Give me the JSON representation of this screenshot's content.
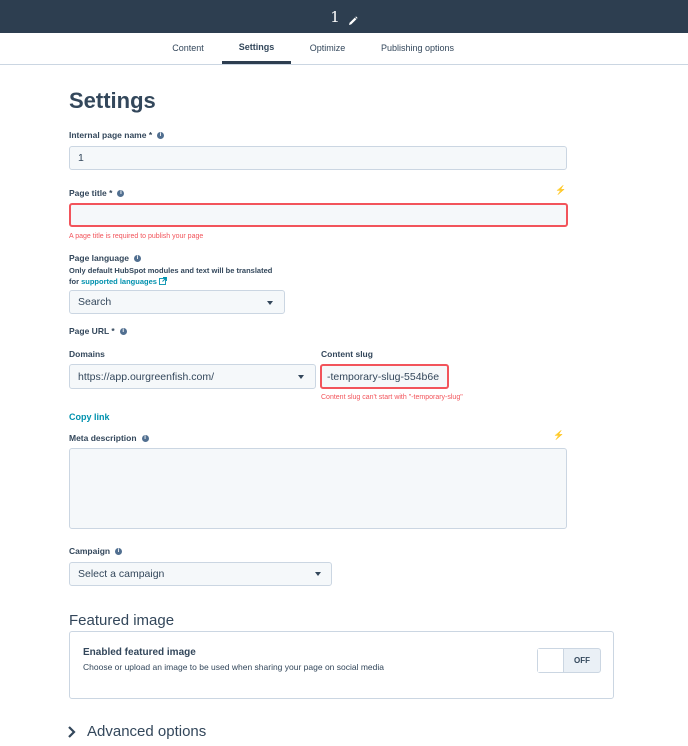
{
  "header": {
    "title": "1",
    "edit_icon": "pencil-icon"
  },
  "tabs": [
    {
      "label": "Content",
      "active": false
    },
    {
      "label": "Settings",
      "active": true
    },
    {
      "label": "Optimize",
      "active": false
    },
    {
      "label": "Publishing options",
      "active": false
    }
  ],
  "page": {
    "heading": "Settings"
  },
  "internal_name": {
    "label": "Internal page name *",
    "value": "1"
  },
  "page_title": {
    "label": "Page title *",
    "value": "",
    "error": "A page title is required to publish your page"
  },
  "page_language": {
    "label": "Page language",
    "helper_line1": "Only default HubSpot modules and text will be translated",
    "helper_prefix": "for ",
    "helper_link": "supported languages",
    "selected": "Search"
  },
  "page_url": {
    "label": "Page URL *",
    "domains_label": "Domains",
    "domain_value": "https://app.ourgreenfish.com/",
    "slug_label": "Content slug",
    "slug_value": "-temporary-slug-554b6e",
    "slug_error": "Content slug can't start with \"-temporary-slug\"",
    "copy_link": "Copy link"
  },
  "meta_description": {
    "label": "Meta description",
    "value": ""
  },
  "campaign": {
    "label": "Campaign",
    "placeholder": "Select a campaign"
  },
  "featured_image": {
    "section_title": "Featured image",
    "card_title": "Enabled featured image",
    "card_desc": "Choose or upload an image to be used when sharing your page on social media",
    "toggle_state": "OFF"
  },
  "advanced": {
    "label": "Advanced options"
  },
  "colors": {
    "header_bg": "#2d3e50",
    "error": "#f2545b",
    "link": "#0091ae",
    "text": "#33475b"
  }
}
